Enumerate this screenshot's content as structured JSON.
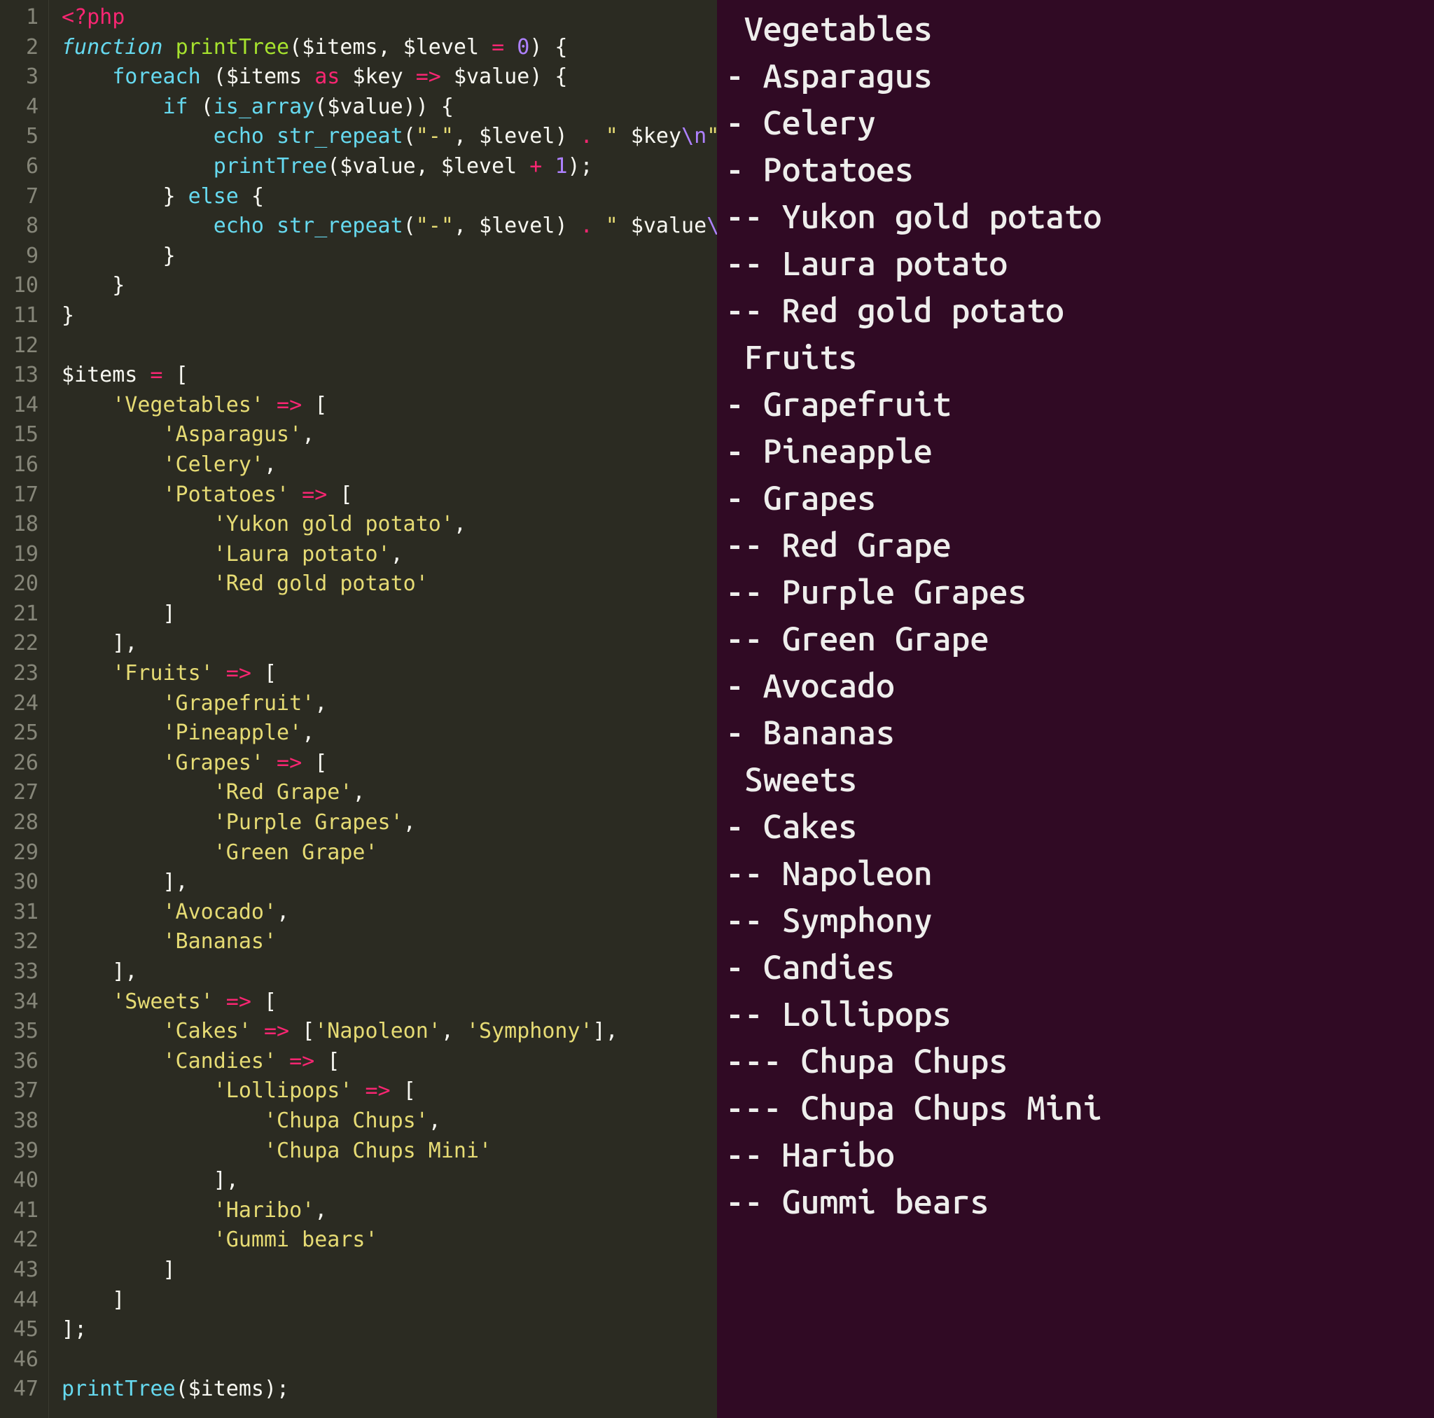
{
  "editor": {
    "line_numbers": [
      "1",
      "2",
      "3",
      "4",
      "5",
      "6",
      "7",
      "8",
      "9",
      "10",
      "11",
      "12",
      "13",
      "14",
      "15",
      "16",
      "17",
      "18",
      "19",
      "20",
      "21",
      "22",
      "23",
      "24",
      "25",
      "26",
      "27",
      "28",
      "29",
      "30",
      "31",
      "32",
      "33",
      "34",
      "35",
      "36",
      "37",
      "38",
      "39",
      "40",
      "41",
      "42",
      "43",
      "44",
      "45",
      "46",
      "47"
    ],
    "lines": [
      [
        {
          "t": "<?php",
          "c": "tag"
        }
      ],
      [
        {
          "t": "function ",
          "c": "kw"
        },
        {
          "t": "printTree",
          "c": "fn"
        },
        {
          "t": "(",
          "c": "punct"
        },
        {
          "t": "$items",
          "c": "var"
        },
        {
          "t": ", ",
          "c": "punct"
        },
        {
          "t": "$level",
          "c": "var"
        },
        {
          "t": " = ",
          "c": "op"
        },
        {
          "t": "0",
          "c": "num"
        },
        {
          "t": ") {",
          "c": "punct"
        }
      ],
      [
        {
          "t": "    ",
          "c": "punct"
        },
        {
          "t": "foreach ",
          "c": "kwni"
        },
        {
          "t": "(",
          "c": "punct"
        },
        {
          "t": "$items",
          "c": "var"
        },
        {
          "t": " as ",
          "c": "op"
        },
        {
          "t": "$key",
          "c": "var"
        },
        {
          "t": " => ",
          "c": "op"
        },
        {
          "t": "$value",
          "c": "var"
        },
        {
          "t": ") {",
          "c": "punct"
        }
      ],
      [
        {
          "t": "        ",
          "c": "punct"
        },
        {
          "t": "if ",
          "c": "kwni"
        },
        {
          "t": "(",
          "c": "punct"
        },
        {
          "t": "is_array",
          "c": "call"
        },
        {
          "t": "(",
          "c": "punct"
        },
        {
          "t": "$value",
          "c": "var"
        },
        {
          "t": ")) {",
          "c": "punct"
        }
      ],
      [
        {
          "t": "            ",
          "c": "punct"
        },
        {
          "t": "echo ",
          "c": "kwni"
        },
        {
          "t": "str_repeat",
          "c": "call"
        },
        {
          "t": "(",
          "c": "punct"
        },
        {
          "t": "\"-\"",
          "c": "str"
        },
        {
          "t": ", ",
          "c": "punct"
        },
        {
          "t": "$level",
          "c": "var"
        },
        {
          "t": ") ",
          "c": "punct"
        },
        {
          "t": ". ",
          "c": "op"
        },
        {
          "t": "\" ",
          "c": "str"
        },
        {
          "t": "$key",
          "c": "var"
        },
        {
          "t": "\\n",
          "c": "esc"
        },
        {
          "t": "\"",
          "c": "str"
        },
        {
          "t": ";",
          "c": "punct"
        }
      ],
      [
        {
          "t": "            ",
          "c": "punct"
        },
        {
          "t": "printTree",
          "c": "call"
        },
        {
          "t": "(",
          "c": "punct"
        },
        {
          "t": "$value",
          "c": "var"
        },
        {
          "t": ", ",
          "c": "punct"
        },
        {
          "t": "$level",
          "c": "var"
        },
        {
          "t": " + ",
          "c": "op"
        },
        {
          "t": "1",
          "c": "num"
        },
        {
          "t": ");",
          "c": "punct"
        }
      ],
      [
        {
          "t": "        } ",
          "c": "punct"
        },
        {
          "t": "else ",
          "c": "kwni"
        },
        {
          "t": "{",
          "c": "punct"
        }
      ],
      [
        {
          "t": "            ",
          "c": "punct"
        },
        {
          "t": "echo ",
          "c": "kwni"
        },
        {
          "t": "str_repeat",
          "c": "call"
        },
        {
          "t": "(",
          "c": "punct"
        },
        {
          "t": "\"-\"",
          "c": "str"
        },
        {
          "t": ", ",
          "c": "punct"
        },
        {
          "t": "$level",
          "c": "var"
        },
        {
          "t": ") ",
          "c": "punct"
        },
        {
          "t": ". ",
          "c": "op"
        },
        {
          "t": "\" ",
          "c": "str"
        },
        {
          "t": "$value",
          "c": "var"
        },
        {
          "t": "\\n",
          "c": "esc"
        },
        {
          "t": "\"",
          "c": "str"
        },
        {
          "t": ";",
          "c": "punct"
        }
      ],
      [
        {
          "t": "        }",
          "c": "punct"
        }
      ],
      [
        {
          "t": "    }",
          "c": "punct"
        }
      ],
      [
        {
          "t": "}",
          "c": "punct"
        }
      ],
      [],
      [
        {
          "t": "$items",
          "c": "var"
        },
        {
          "t": " = ",
          "c": "op"
        },
        {
          "t": "[",
          "c": "punct"
        }
      ],
      [
        {
          "t": "    ",
          "c": "punct"
        },
        {
          "t": "'Vegetables'",
          "c": "str"
        },
        {
          "t": " => ",
          "c": "op"
        },
        {
          "t": "[",
          "c": "punct"
        }
      ],
      [
        {
          "t": "        ",
          "c": "punct"
        },
        {
          "t": "'Asparagus'",
          "c": "str"
        },
        {
          "t": ",",
          "c": "punct"
        }
      ],
      [
        {
          "t": "        ",
          "c": "punct"
        },
        {
          "t": "'Celery'",
          "c": "str"
        },
        {
          "t": ",",
          "c": "punct"
        }
      ],
      [
        {
          "t": "        ",
          "c": "punct"
        },
        {
          "t": "'Potatoes'",
          "c": "str"
        },
        {
          "t": " => ",
          "c": "op"
        },
        {
          "t": "[",
          "c": "punct"
        }
      ],
      [
        {
          "t": "            ",
          "c": "punct"
        },
        {
          "t": "'Yukon gold potato'",
          "c": "str"
        },
        {
          "t": ",",
          "c": "punct"
        }
      ],
      [
        {
          "t": "            ",
          "c": "punct"
        },
        {
          "t": "'Laura potato'",
          "c": "str"
        },
        {
          "t": ",",
          "c": "punct"
        }
      ],
      [
        {
          "t": "            ",
          "c": "punct"
        },
        {
          "t": "'Red gold potato'",
          "c": "str"
        }
      ],
      [
        {
          "t": "        ]",
          "c": "punct"
        }
      ],
      [
        {
          "t": "    ],",
          "c": "punct"
        }
      ],
      [
        {
          "t": "    ",
          "c": "punct"
        },
        {
          "t": "'Fruits'",
          "c": "str"
        },
        {
          "t": " => ",
          "c": "op"
        },
        {
          "t": "[",
          "c": "punct"
        }
      ],
      [
        {
          "t": "        ",
          "c": "punct"
        },
        {
          "t": "'Grapefruit'",
          "c": "str"
        },
        {
          "t": ",",
          "c": "punct"
        }
      ],
      [
        {
          "t": "        ",
          "c": "punct"
        },
        {
          "t": "'Pineapple'",
          "c": "str"
        },
        {
          "t": ",",
          "c": "punct"
        }
      ],
      [
        {
          "t": "        ",
          "c": "punct"
        },
        {
          "t": "'Grapes'",
          "c": "str"
        },
        {
          "t": " => ",
          "c": "op"
        },
        {
          "t": "[",
          "c": "punct"
        }
      ],
      [
        {
          "t": "            ",
          "c": "punct"
        },
        {
          "t": "'Red Grape'",
          "c": "str"
        },
        {
          "t": ",",
          "c": "punct"
        }
      ],
      [
        {
          "t": "            ",
          "c": "punct"
        },
        {
          "t": "'Purple Grapes'",
          "c": "str"
        },
        {
          "t": ",",
          "c": "punct"
        }
      ],
      [
        {
          "t": "            ",
          "c": "punct"
        },
        {
          "t": "'Green Grape'",
          "c": "str"
        }
      ],
      [
        {
          "t": "        ],",
          "c": "punct"
        }
      ],
      [
        {
          "t": "        ",
          "c": "punct"
        },
        {
          "t": "'Avocado'",
          "c": "str"
        },
        {
          "t": ",",
          "c": "punct"
        }
      ],
      [
        {
          "t": "        ",
          "c": "punct"
        },
        {
          "t": "'Bananas'",
          "c": "str"
        }
      ],
      [
        {
          "t": "    ],",
          "c": "punct"
        }
      ],
      [
        {
          "t": "    ",
          "c": "punct"
        },
        {
          "t": "'Sweets'",
          "c": "str"
        },
        {
          "t": " => ",
          "c": "op"
        },
        {
          "t": "[",
          "c": "punct"
        }
      ],
      [
        {
          "t": "        ",
          "c": "punct"
        },
        {
          "t": "'Cakes'",
          "c": "str"
        },
        {
          "t": " => ",
          "c": "op"
        },
        {
          "t": "[",
          "c": "punct"
        },
        {
          "t": "'Napoleon'",
          "c": "str"
        },
        {
          "t": ", ",
          "c": "punct"
        },
        {
          "t": "'Symphony'",
          "c": "str"
        },
        {
          "t": "],",
          "c": "punct"
        }
      ],
      [
        {
          "t": "        ",
          "c": "punct"
        },
        {
          "t": "'Candies'",
          "c": "str"
        },
        {
          "t": " => ",
          "c": "op"
        },
        {
          "t": "[",
          "c": "punct"
        }
      ],
      [
        {
          "t": "            ",
          "c": "punct"
        },
        {
          "t": "'Lollipops'",
          "c": "str"
        },
        {
          "t": " => ",
          "c": "op"
        },
        {
          "t": "[",
          "c": "punct"
        }
      ],
      [
        {
          "t": "                ",
          "c": "punct"
        },
        {
          "t": "'Chupa Chups'",
          "c": "str"
        },
        {
          "t": ",",
          "c": "punct"
        }
      ],
      [
        {
          "t": "                ",
          "c": "punct"
        },
        {
          "t": "'Chupa Chups Mini'",
          "c": "str"
        }
      ],
      [
        {
          "t": "            ],",
          "c": "punct"
        }
      ],
      [
        {
          "t": "            ",
          "c": "punct"
        },
        {
          "t": "'Haribo'",
          "c": "str"
        },
        {
          "t": ",",
          "c": "punct"
        }
      ],
      [
        {
          "t": "            ",
          "c": "punct"
        },
        {
          "t": "'Gummi bears'",
          "c": "str"
        }
      ],
      [
        {
          "t": "        ]",
          "c": "punct"
        }
      ],
      [
        {
          "t": "    ]",
          "c": "punct"
        }
      ],
      [
        {
          "t": "];",
          "c": "punct"
        }
      ],
      [],
      [
        {
          "t": "printTree",
          "c": "call"
        },
        {
          "t": "(",
          "c": "punct"
        },
        {
          "t": "$items",
          "c": "var"
        },
        {
          "t": ");",
          "c": "punct"
        }
      ]
    ]
  },
  "terminal": {
    "lines": [
      " Vegetables",
      "- Asparagus",
      "- Celery",
      "- Potatoes",
      "-- Yukon gold potato",
      "-- Laura potato",
      "-- Red gold potato",
      " Fruits",
      "- Grapefruit",
      "- Pineapple",
      "- Grapes",
      "-- Red Grape",
      "-- Purple Grapes",
      "-- Green Grape",
      "- Avocado",
      "- Bananas",
      " Sweets",
      "- Cakes",
      "-- Napoleon",
      "-- Symphony",
      "- Candies",
      "-- Lollipops",
      "--- Chupa Chups",
      "--- Chupa Chups Mini",
      "-- Haribo",
      "-- Gummi bears"
    ]
  }
}
